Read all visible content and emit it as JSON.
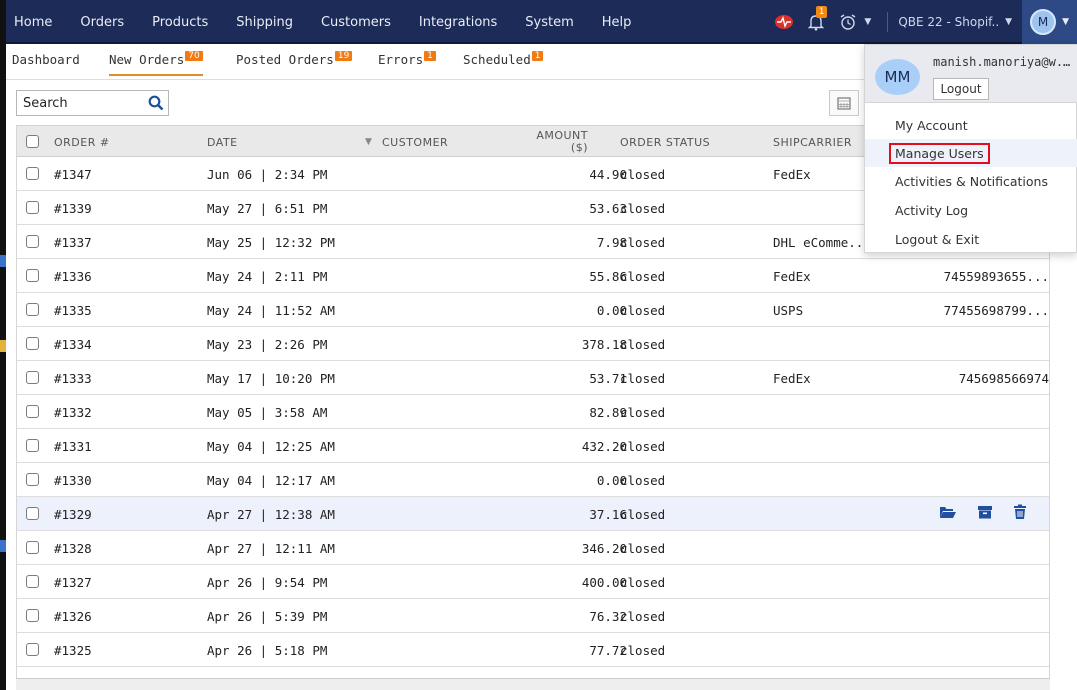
{
  "nav": {
    "items": [
      "Home",
      "Orders",
      "Products",
      "Shipping",
      "Customers",
      "Integrations",
      "System",
      "Help"
    ],
    "notification_count": "1",
    "store_label": "QBE 22 - Shopif..",
    "avatar_initial": "M"
  },
  "tabs": [
    {
      "label": "Dashboard",
      "badge": ""
    },
    {
      "label": "New Orders",
      "badge": "70"
    },
    {
      "label": "Posted Orders",
      "badge": "19"
    },
    {
      "label": "Errors",
      "badge": "1"
    },
    {
      "label": "Scheduled",
      "badge": "1"
    }
  ],
  "search": {
    "placeholder": "Search"
  },
  "table": {
    "headers": {
      "order": "ORDER #",
      "date": "DATE",
      "customer": "CUSTOMER",
      "amount": "AMOUNT",
      "amount_unit": "($)",
      "status": "ORDER STATUS",
      "shipcarrier": "SHIPCARRIER"
    },
    "rows": [
      {
        "order": "#1347",
        "date": "Jun 06 | 2:34 PM",
        "amount": "44.90",
        "status": "closed",
        "carrier": "FedEx",
        "tracking": ""
      },
      {
        "order": "#1339",
        "date": "May 27 | 6:51 PM",
        "amount": "53.63",
        "status": "closed",
        "carrier": "",
        "tracking": ""
      },
      {
        "order": "#1337",
        "date": "May 25 | 12:32 PM",
        "amount": "7.98",
        "status": "closed",
        "carrier": "DHL eComme..",
        "tracking": ""
      },
      {
        "order": "#1336",
        "date": "May 24 | 2:11 PM",
        "amount": "55.86",
        "status": "closed",
        "carrier": "FedEx",
        "tracking": "74559893655..."
      },
      {
        "order": "#1335",
        "date": "May 24 | 11:52 AM",
        "amount": "0.00",
        "status": "closed",
        "carrier": "USPS",
        "tracking": "77455698799..."
      },
      {
        "order": "#1334",
        "date": "May 23 | 2:26 PM",
        "amount": "378.18",
        "status": "closed",
        "carrier": "",
        "tracking": ""
      },
      {
        "order": "#1333",
        "date": "May 17 | 10:20 PM",
        "amount": "53.71",
        "status": "closed",
        "carrier": "FedEx",
        "tracking": "745698566974"
      },
      {
        "order": "#1332",
        "date": "May 05 | 3:58 AM",
        "amount": "82.89",
        "status": "closed",
        "carrier": "",
        "tracking": ""
      },
      {
        "order": "#1331",
        "date": "May 04 | 12:25 AM",
        "amount": "432.20",
        "status": "closed",
        "carrier": "",
        "tracking": ""
      },
      {
        "order": "#1330",
        "date": "May 04 | 12:17 AM",
        "amount": "0.00",
        "status": "closed",
        "carrier": "",
        "tracking": ""
      },
      {
        "order": "#1329",
        "date": "Apr 27 | 12:38 AM",
        "amount": "37.16",
        "status": "closed",
        "carrier": "",
        "tracking": ""
      },
      {
        "order": "#1328",
        "date": "Apr 27 | 12:11 AM",
        "amount": "346.20",
        "status": "closed",
        "carrier": "",
        "tracking": ""
      },
      {
        "order": "#1327",
        "date": "Apr 26 | 9:54 PM",
        "amount": "400.00",
        "status": "closed",
        "carrier": "",
        "tracking": ""
      },
      {
        "order": "#1326",
        "date": "Apr 26 | 5:39 PM",
        "amount": "76.32",
        "status": "closed",
        "carrier": "",
        "tracking": ""
      },
      {
        "order": "#1325",
        "date": "Apr 26 | 5:18 PM",
        "amount": "77.72",
        "status": "closed",
        "carrier": "",
        "tracking": ""
      }
    ],
    "highlighted_row": 10
  },
  "user_menu": {
    "avatar": "MM",
    "email": "manish.manoriya@w...",
    "logout_button": "Logout",
    "items": [
      "My Account",
      "Manage Users",
      "Activities & Notifications",
      "Activity Log",
      "Logout & Exit"
    ],
    "selected_item": "Manage Users"
  },
  "colors": {
    "nav_bg": "#1c2b57",
    "badge": "#f07b13",
    "highlight_box": "#e20e1d",
    "row_highlight": "#edf1fb"
  }
}
